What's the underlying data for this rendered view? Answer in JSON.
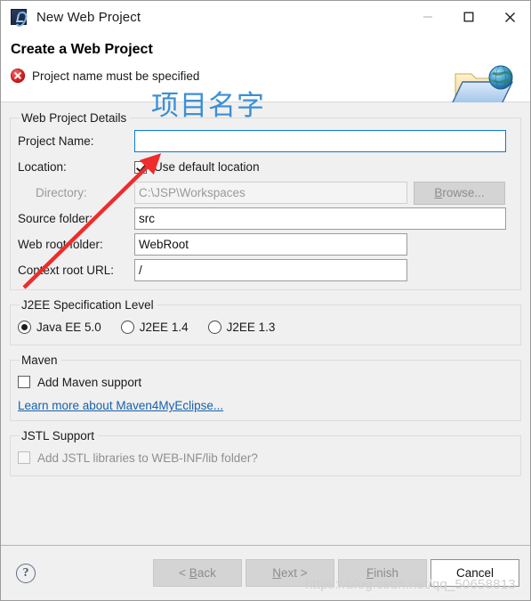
{
  "window": {
    "title": "New Web Project",
    "app_icon": "myeclipse-icon",
    "controls": {
      "minimize": "minimize-icon",
      "maximize": "maximize-icon",
      "close": "close-icon"
    }
  },
  "header": {
    "title": "Create a Web Project",
    "error_icon": "error-circle-icon",
    "error_message": "Project name must be specified",
    "graphic": "web-project-folder-globe-icon"
  },
  "annotation": {
    "text": "项目名字",
    "color": "#3d8fd4",
    "arrow_color": "#ee2c2c"
  },
  "details_group": {
    "legend": "Web Project Details",
    "project_name": {
      "label": "Project Name:",
      "value": "",
      "placeholder": ""
    },
    "location": {
      "label": "Location:",
      "checkbox_label": "Use default location",
      "checked": true
    },
    "directory": {
      "label": "Directory:",
      "value": "C:\\JSP\\Workspaces",
      "disabled": true,
      "browse_label": "Browse..."
    },
    "source_folder": {
      "label": "Source folder:",
      "value": "src"
    },
    "web_root_folder": {
      "label": "Web root folder:",
      "value": "WebRoot"
    },
    "context_root_url": {
      "label": "Context root URL:",
      "value": "/"
    }
  },
  "j2ee_group": {
    "legend": "J2EE Specification Level",
    "options": [
      {
        "label": "Java EE 5.0",
        "selected": true
      },
      {
        "label": "J2EE 1.4",
        "selected": false
      },
      {
        "label": "J2EE 1.3",
        "selected": false
      }
    ]
  },
  "maven_group": {
    "legend": "Maven",
    "checkbox_label": "Add Maven support",
    "checked": false,
    "link_label": "Learn more about Maven4MyEclipse..."
  },
  "jstl_group": {
    "legend": "JSTL Support",
    "checkbox_label": "Add JSTL libraries to WEB-INF/lib folder?",
    "checked": false,
    "disabled": true
  },
  "footer": {
    "help_icon": "help-question-icon",
    "buttons": [
      {
        "label": "< Back",
        "underline": "B",
        "enabled": false
      },
      {
        "label": "Next >",
        "underline": "N",
        "enabled": false
      },
      {
        "label": "Finish",
        "underline": "F",
        "enabled": false
      },
      {
        "label": "Cancel",
        "underline": "",
        "enabled": true
      }
    ]
  },
  "watermark": {
    "text": "https://blog.csdn.net/qq_50658813"
  }
}
